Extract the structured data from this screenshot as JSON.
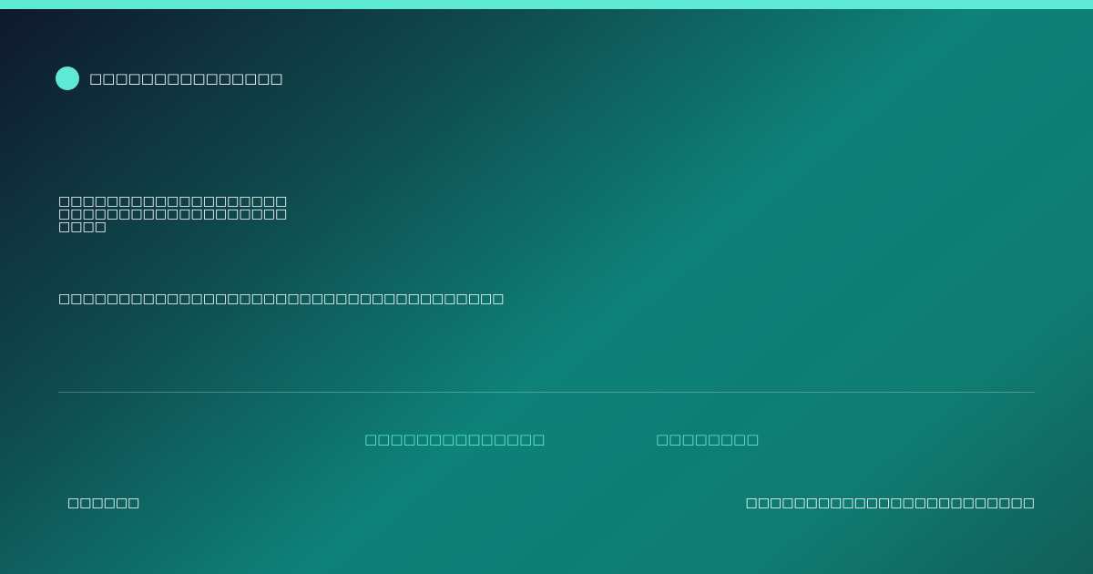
{
  "colors": {
    "accent": "#5eead4",
    "text": "#ffffff",
    "background_start": "#0f172a",
    "background_mid": "#0e8178",
    "background_end": "#115e57"
  },
  "brand": {
    "icon": "brand-dot-icon",
    "name": "□□□□□□□□□□□□□□□"
  },
  "hero": {
    "headline": "□□□□□□□□□□□□□□□□□□□□□□□□□□□□□□□□□□□□□□□□□□",
    "subline": "□□□□□□□□□□□□□□□□□□□□□□□□□□□□□□□□□□□□□"
  },
  "links": [
    {
      "label": "□□□□□□□□□□□□□□"
    },
    {
      "label": "□□□□□□□□"
    }
  ],
  "footer": {
    "left": "□□□□□□",
    "right": "□□□□□□□□□□□□□□□□□□□□□□□□"
  }
}
